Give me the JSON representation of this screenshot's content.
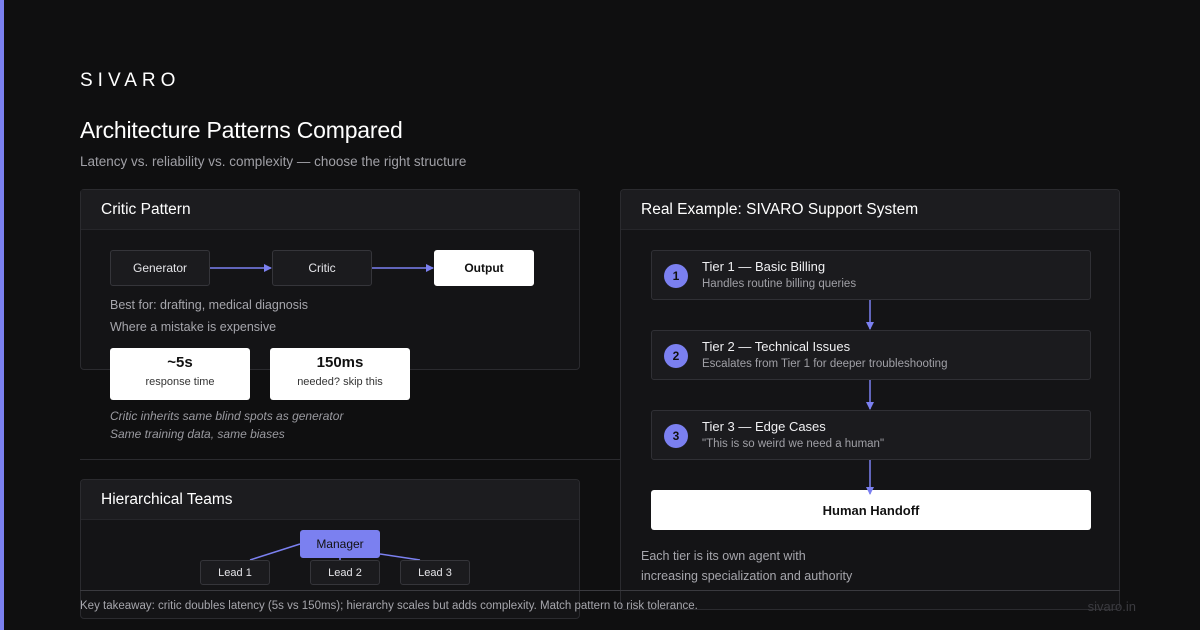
{
  "brand": "SIVARO",
  "title": "Architecture Patterns Compared",
  "subtitle": "Latency vs. reliability vs. complexity — choose the right structure",
  "critic": {
    "heading": "Critic Pattern",
    "nodes": [
      "Generator",
      "Critic",
      "Output"
    ],
    "best_for": "Best for: drafting, medical diagnosis",
    "where": "Where a mistake is expensive",
    "stats": [
      {
        "value": "~5s",
        "label": "response time"
      },
      {
        "value": "150ms",
        "label": "needed? skip this"
      }
    ],
    "notes": [
      "Critic inherits same blind spots as generator",
      "Same training data, same biases"
    ]
  },
  "hierarchy": {
    "heading": "Hierarchical Teams",
    "manager": "Manager",
    "leads": [
      "Lead 1",
      "Lead 2",
      "Lead 3"
    ]
  },
  "support": {
    "heading": "Real Example: SIVARO Support System",
    "tiers": [
      {
        "num": "1",
        "title": "Tier 1 — Basic Billing",
        "desc": "Handles routine billing queries"
      },
      {
        "num": "2",
        "title": "Tier 2 — Technical Issues",
        "desc": "Escalates from Tier 1 for deeper troubleshooting"
      },
      {
        "num": "3",
        "title": "Tier 3 — Edge Cases",
        "desc": "\"This is so weird we need a human\""
      }
    ],
    "handoff": "Human Handoff",
    "notes": [
      "Each tier is its own agent with",
      "increasing specialization and authority"
    ]
  },
  "footer": "Key takeaway: critic doubles latency (5s vs 150ms); hierarchy scales but adds complexity. Match pattern to risk tolerance.",
  "domain_text": "sivaro.in",
  "colors": {
    "accent": "#7b80f0",
    "background": "#0f0f10",
    "panel": "#141416"
  }
}
